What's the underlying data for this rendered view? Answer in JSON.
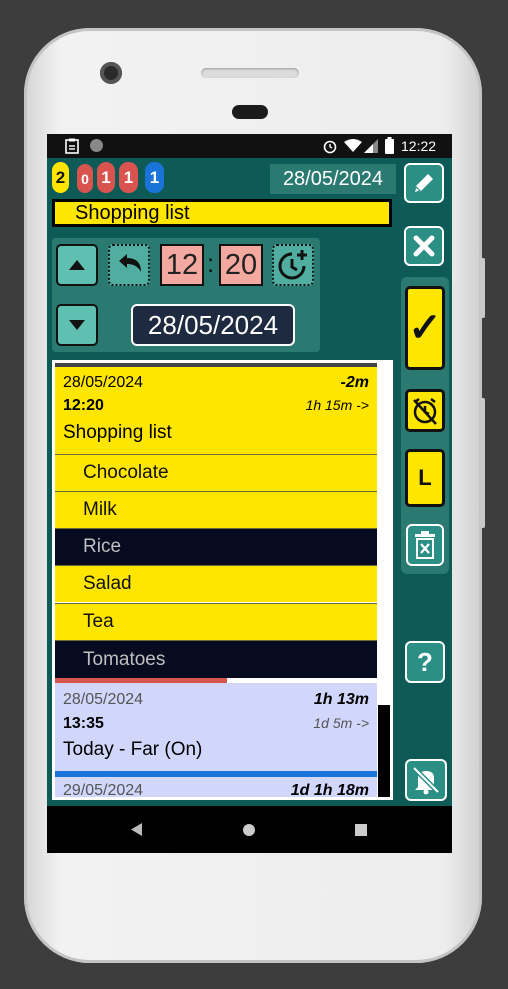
{
  "status_bar": {
    "time": "12:22"
  },
  "counters": [
    {
      "value": "2",
      "color": "#ffe600",
      "text_color": "#111111"
    },
    {
      "value": "0",
      "color": "#d9534f",
      "text_color": "#ffffff"
    },
    {
      "value": "1",
      "color": "#d9534f",
      "text_color": "#ffffff"
    },
    {
      "value": "1",
      "color": "#d9534f",
      "text_color": "#ffffff"
    },
    {
      "value": "1",
      "color": "#1a73d9",
      "text_color": "#ffffff"
    }
  ],
  "header": {
    "date": "28/05/2024",
    "title": "Shopping list"
  },
  "controls": {
    "hour": "12",
    "minute": "20",
    "separator": ":",
    "date": "28/05/2024"
  },
  "side_buttons": {
    "confirm": "✓",
    "l_label": "L",
    "help": "?"
  },
  "list": {
    "cards": [
      {
        "date": "28/05/2024",
        "delta": "-2m",
        "time": "12:20",
        "duration": "1h 15m ->",
        "title": "Shopping list",
        "items": [
          {
            "label": "Chocolate",
            "checked": true
          },
          {
            "label": "Milk",
            "checked": true
          },
          {
            "label": "Rice",
            "checked": false
          },
          {
            "label": "Salad",
            "checked": true
          },
          {
            "label": "Tea",
            "checked": true
          },
          {
            "label": "Tomatoes",
            "checked": false
          }
        ]
      },
      {
        "date": "28/05/2024",
        "delta": "1h 13m",
        "time": "13:35",
        "duration": "1d 5m ->",
        "title": "Today - Far (On)"
      },
      {
        "date": "29/05/2024",
        "delta": "1d 1h 18m"
      }
    ]
  },
  "colors": {
    "teal_bg": "#0d5a57",
    "panel": "#2b7a72",
    "yellow": "#ffe600",
    "blue_card": "#d1d6fb",
    "dark_item": "#070b1f"
  }
}
